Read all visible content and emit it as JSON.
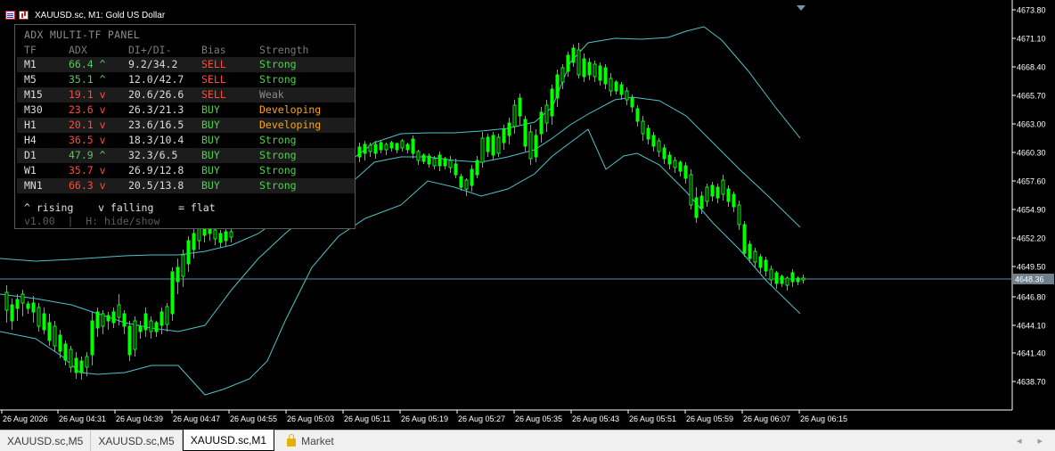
{
  "window": {
    "title": "XAUUSD.sc, M1:  Gold US Dollar"
  },
  "chart": {
    "current_price": "4648.36",
    "price_levels": [
      "4673.80",
      "4671.10",
      "4668.40",
      "4665.70",
      "4663.00",
      "4660.30",
      "4657.60",
      "4654.90",
      "4652.20",
      "4649.50",
      "4646.80",
      "4644.10",
      "4641.40",
      "4638.70"
    ],
    "time_labels": [
      "26 Aug 2026",
      "26 Aug 04:31",
      "26 Aug 04:39",
      "26 Aug 04:47",
      "26 Aug 04:55",
      "26 Aug 05:03",
      "26 Aug 05:11",
      "26 Aug 05:19",
      "26 Aug 05:27",
      "26 Aug 05:35",
      "26 Aug 05:43",
      "26 Aug 05:51",
      "26 Aug 05:59",
      "26 Aug 06:07",
      "26 Aug 06:15"
    ],
    "colors": {
      "background": "#000000",
      "candle": "#00ff00",
      "bands": "#4fc3c7",
      "price_line": "#5f8fa8",
      "axis_text": "#ffffff"
    }
  },
  "panel": {
    "title": "ADX MULTI-TF PANEL",
    "headers": {
      "tf": "TF",
      "adx": "ADX",
      "di": "DI+/DI-",
      "bias": "Bias",
      "strength": "Strength"
    },
    "rows": [
      {
        "tf": "M1",
        "adx": "66.4 ^",
        "adx_color": "#58c95a",
        "di": "9.2/34.2",
        "bias": "SELL",
        "bias_color": "#ff4a3a",
        "strength": "Strong",
        "strength_color": "#4cd24c"
      },
      {
        "tf": "M5",
        "adx": "35.1 ^",
        "adx_color": "#58c95a",
        "di": "12.0/42.7",
        "bias": "SELL",
        "bias_color": "#ff4a3a",
        "strength": "Strong",
        "strength_color": "#4cd24c"
      },
      {
        "tf": "M15",
        "adx": "19.1 v",
        "adx_color": "#ff4a3a",
        "di": "20.6/26.6",
        "bias": "SELL",
        "bias_color": "#ff4a3a",
        "strength": "Weak",
        "strength_color": "#8a8a8a"
      },
      {
        "tf": "M30",
        "adx": "23.6 v",
        "adx_color": "#ff4a3a",
        "di": "26.3/21.3",
        "bias": "BUY",
        "bias_color": "#4cd24c",
        "strength": "Developing",
        "strength_color": "#ffa500"
      },
      {
        "tf": "H1",
        "adx": "20.1 v",
        "adx_color": "#ff4a3a",
        "di": "23.6/16.5",
        "bias": "BUY",
        "bias_color": "#4cd24c",
        "strength": "Developing",
        "strength_color": "#ffa500"
      },
      {
        "tf": "H4",
        "adx": "36.5 v",
        "adx_color": "#ff4a3a",
        "di": "18.3/10.4",
        "bias": "BUY",
        "bias_color": "#4cd24c",
        "strength": "Strong",
        "strength_color": "#4cd24c"
      },
      {
        "tf": "D1",
        "adx": "47.9 ^",
        "adx_color": "#58c95a",
        "di": "32.3/6.5",
        "bias": "BUY",
        "bias_color": "#4cd24c",
        "strength": "Strong",
        "strength_color": "#4cd24c"
      },
      {
        "tf": "W1",
        "adx": "35.7 v",
        "adx_color": "#ff4a3a",
        "di": "26.9/12.8",
        "bias": "BUY",
        "bias_color": "#4cd24c",
        "strength": "Strong",
        "strength_color": "#4cd24c"
      },
      {
        "tf": "MN1",
        "adx": "66.3 v",
        "adx_color": "#ff4a3a",
        "di": "20.5/13.8",
        "bias": "BUY",
        "bias_color": "#4cd24c",
        "strength": "Strong",
        "strength_color": "#4cd24c"
      }
    ],
    "legend": "^ rising    v falling    = flat",
    "version": "v1.00",
    "separator": "|",
    "hint": "H: hide/show"
  },
  "tabs": [
    {
      "label": "XAUUSD.sc,M5",
      "active": false
    },
    {
      "label": "XAUUSD.sc,M5",
      "active": false
    },
    {
      "label": "XAUUSD.sc,M1",
      "active": true
    }
  ],
  "market_tab": {
    "label": "Market",
    "icon": "lock-icon"
  },
  "scroll": {
    "left": "◂",
    "right": "▸"
  }
}
